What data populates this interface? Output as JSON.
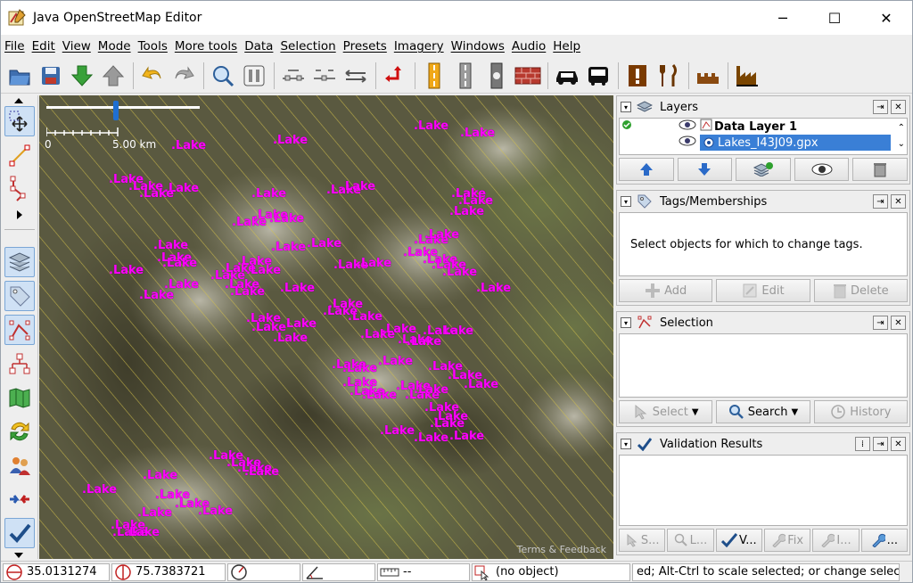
{
  "window": {
    "title": "Java OpenStreetMap Editor",
    "minimize": "─",
    "maximize": "☐",
    "close": "✕"
  },
  "menu": [
    "File",
    "Edit",
    "View",
    "Mode",
    "Tools",
    "More tools",
    "Data",
    "Selection",
    "Presets",
    "Imagery",
    "Windows",
    "Audio",
    "Help"
  ],
  "map": {
    "scale_zero": "0",
    "scale_label": "5.00 km",
    "terms": "Terms & Feedback",
    "label_text": ".Lake",
    "label_color": "#ff00ff",
    "label_count": 84
  },
  "layers_panel": {
    "title": "Layers",
    "layers": [
      {
        "name": "Data Layer 1",
        "active": true,
        "visible": true
      },
      {
        "name": "Lakes_I43J09.gpx",
        "active": false,
        "visible": true,
        "selected": true
      }
    ]
  },
  "tags_panel": {
    "title": "Tags/Memberships",
    "empty_text": "Select objects for which to change tags.",
    "buttons": {
      "add": "Add",
      "edit": "Edit",
      "delete": "Delete"
    }
  },
  "selection_panel": {
    "title": "Selection",
    "buttons": {
      "select": "Select",
      "search": "Search",
      "history": "History"
    }
  },
  "validation_panel": {
    "title": "Validation Results",
    "buttons": {
      "select": "S...",
      "zoom": "L...",
      "validate": "V...",
      "fix": "Fix",
      "ignore": "I...",
      "settings": "..."
    }
  },
  "status": {
    "lat": "35.0131274",
    "lon": "75.7383721",
    "heading": "",
    "angle": "",
    "length": "--",
    "object": "(no object)",
    "hint": "ed; Alt-Ctrl to scale selected; or change selection"
  },
  "colors": {
    "accent": "#3a7fd6",
    "lake_label": "#ff00ff",
    "hatch": "#d4c24a"
  }
}
